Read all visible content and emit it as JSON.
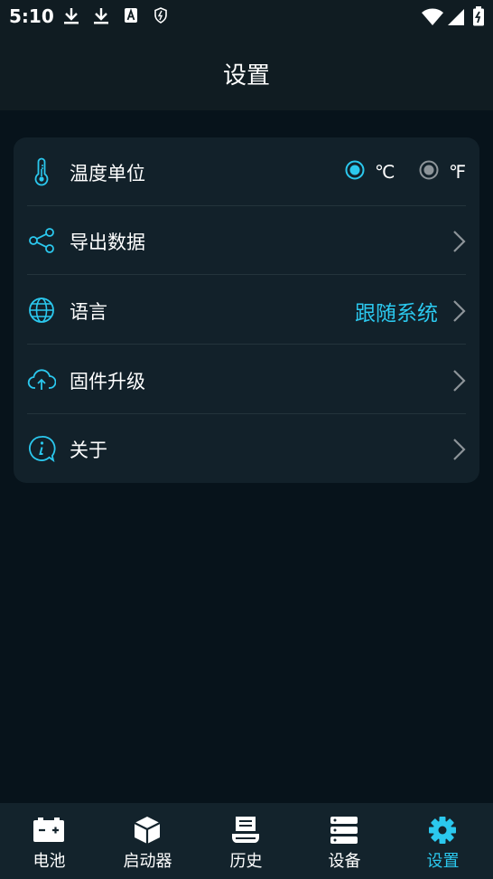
{
  "status": {
    "time": "5:10"
  },
  "header": {
    "title": "设置"
  },
  "settings": {
    "temperature": {
      "label": "温度单位",
      "option_c": "℃",
      "option_f": "℉",
      "selected": "celsius"
    },
    "export": {
      "label": "导出数据"
    },
    "language": {
      "label": "语言",
      "value": "跟随系统"
    },
    "firmware": {
      "label": "固件升级"
    },
    "about": {
      "label": "关于"
    }
  },
  "tabs": [
    {
      "label": "电池",
      "icon": "battery-icon",
      "active": false
    },
    {
      "label": "启动器",
      "icon": "cube-icon",
      "active": false
    },
    {
      "label": "历史",
      "icon": "history-icon",
      "active": false
    },
    {
      "label": "设备",
      "icon": "devices-icon",
      "active": false
    },
    {
      "label": "设置",
      "icon": "gear-icon",
      "active": true
    }
  ],
  "colors": {
    "accent": "#2bc8ee",
    "background": "#07131b",
    "card": "#12212a",
    "bar": "#101c22"
  }
}
